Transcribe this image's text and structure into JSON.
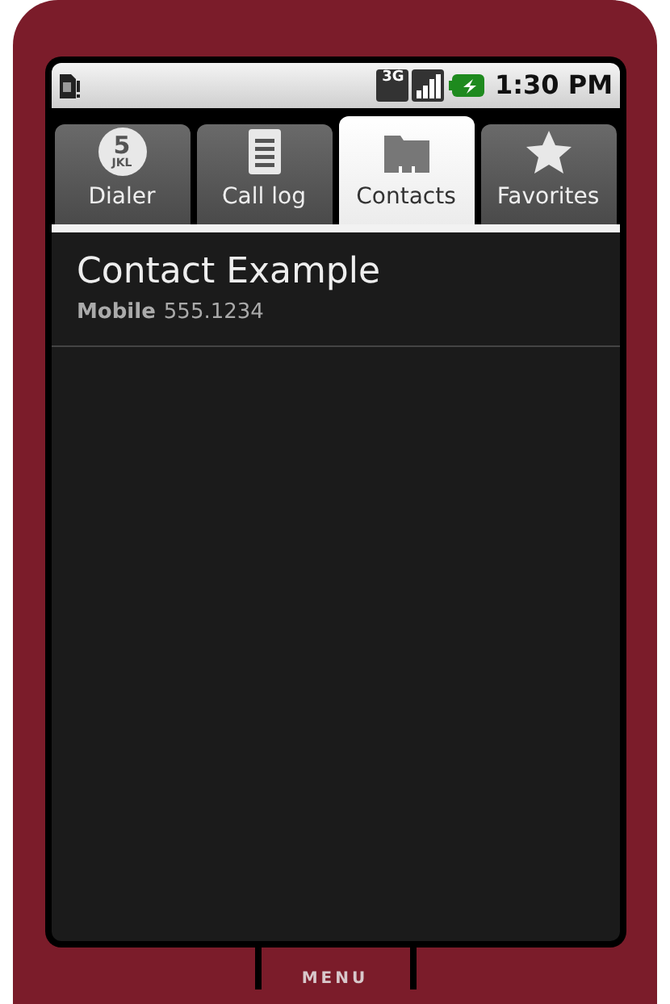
{
  "status_bar": {
    "network": "3G",
    "time": "1:30 PM"
  },
  "tabs": [
    {
      "kind": "dialer",
      "label": "Dialer",
      "selected": false,
      "icon_digit": "5",
      "icon_letters": "JKL"
    },
    {
      "kind": "log",
      "label": "Call log",
      "selected": false
    },
    {
      "kind": "contacts",
      "label": "Contacts",
      "selected": true
    },
    {
      "kind": "favorites",
      "label": "Favorites",
      "selected": false
    }
  ],
  "contacts": [
    {
      "name": "Contact Example",
      "number_type": "Mobile",
      "number": "555.1234"
    }
  ],
  "hardware_button": "MENU"
}
